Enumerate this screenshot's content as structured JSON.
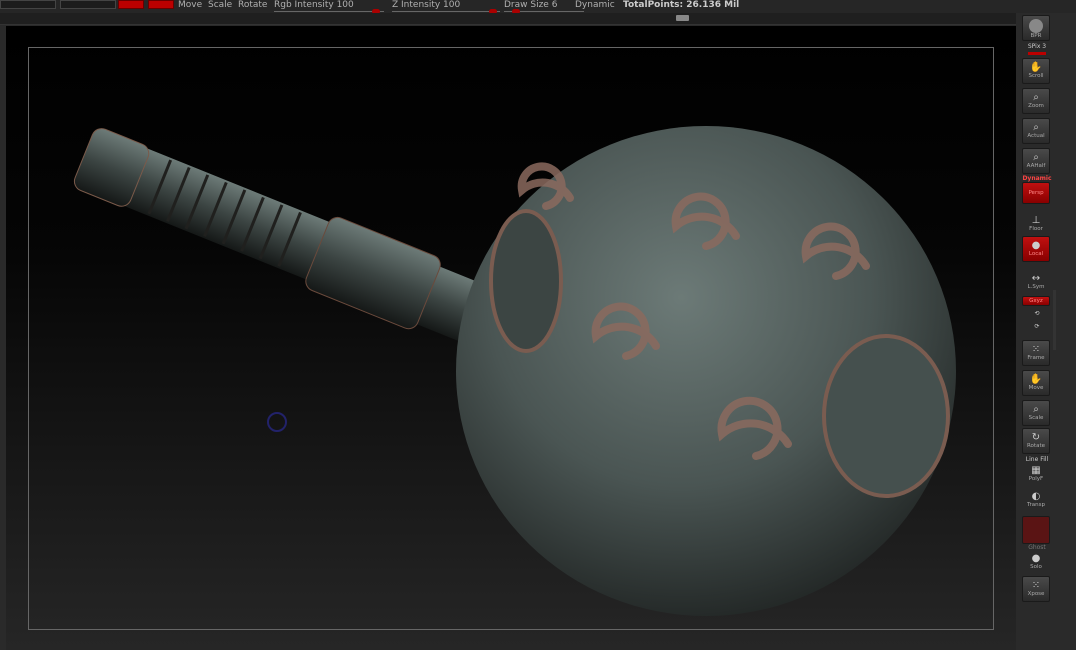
{
  "topbar": {
    "move": "Move",
    "scale": "Scale",
    "rotate": "Rotate",
    "rgb_intensity": "Rgb Intensity 100",
    "z_intensity": "Z Intensity 100",
    "draw_size": "Draw Size 6",
    "dynamic": "Dynamic",
    "total_points": "TotalPoints: 26.136 Mil"
  },
  "tray": {
    "bpr": "BPR",
    "spix": "SPix 3",
    "scroll": "Scroll",
    "zoom": "Zoom",
    "actual": "Actual",
    "aahalf": "AAHalf",
    "dynamic": "Dynamic",
    "persp": "Persp",
    "floor": "Floor",
    "local": "Local",
    "lsym": "L.Sym",
    "gxyz": "Gxyz",
    "frame": "Frame",
    "move": "Move",
    "scale": "Scale",
    "rotate": "Rotate",
    "line_fill": "Line Fill",
    "polyf": "PolyF",
    "transp": "Transp",
    "ghost": "Ghost",
    "solo": "Solo",
    "xpose": "Xpose"
  },
  "colors": {
    "accent": "#b00000",
    "bg": "#2a2a2a"
  }
}
